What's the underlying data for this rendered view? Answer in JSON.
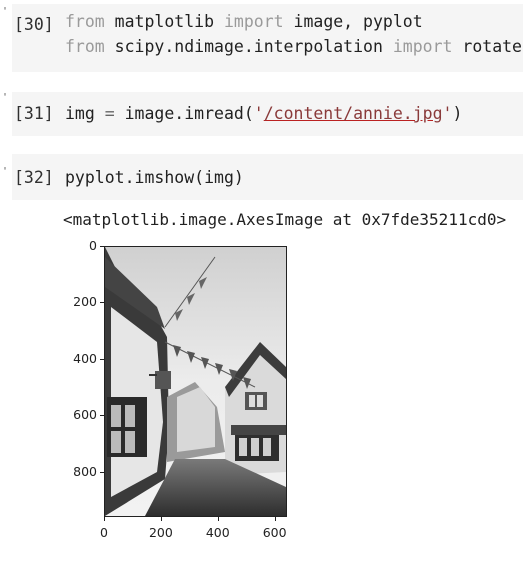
{
  "cells": [
    {
      "prompt": "[30]",
      "line1": {
        "kw1": "from",
        "mod": " matplotlib ",
        "kw2": "import",
        "rest": " image, pyplot"
      },
      "line2": {
        "kw1": "from",
        "mod": " scipy.ndimage.interpolation ",
        "kw2": "import",
        "rest": " rotate"
      }
    },
    {
      "prompt": "[31]",
      "code_pre": "img ",
      "op": "=",
      "code_mid": " image.imread(",
      "str_quote1": "'",
      "str_path": "/content/annie.jpg",
      "str_quote2": "'",
      "code_post": ")"
    },
    {
      "prompt": "[32]",
      "code": "pyplot.imshow(img)",
      "output": "<matplotlib.image.AxesImage at 0x7fde35211cd0>"
    }
  ],
  "chart_data": {
    "type": "image",
    "title": "",
    "xlabel": "",
    "ylabel": "",
    "x_ticks": [
      0,
      200,
      400,
      600
    ],
    "y_ticks": [
      0,
      200,
      400,
      600,
      800
    ],
    "xlim": [
      0,
      640
    ],
    "ylim": [
      960,
      0
    ]
  }
}
